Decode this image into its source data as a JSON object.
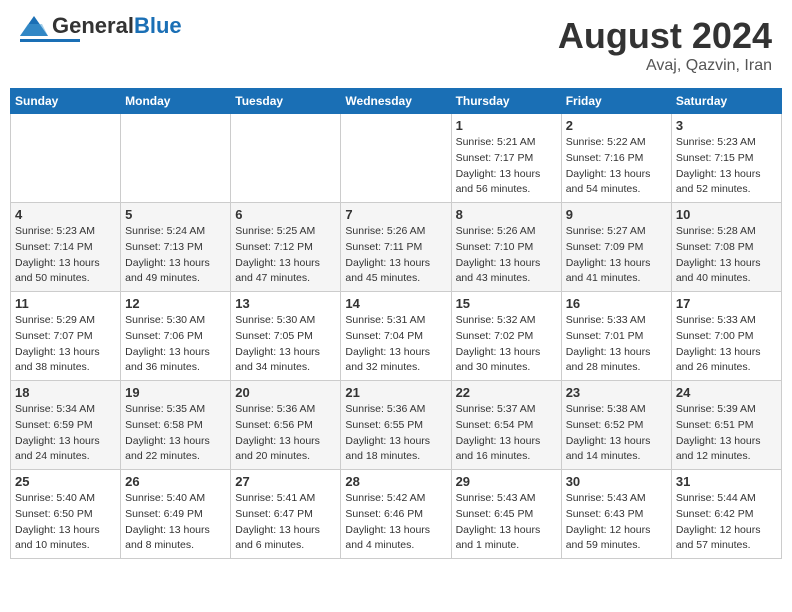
{
  "header": {
    "logo_general": "General",
    "logo_blue": "Blue",
    "month": "August 2024",
    "location": "Avaj, Qazvin, Iran"
  },
  "days_of_week": [
    "Sunday",
    "Monday",
    "Tuesday",
    "Wednesday",
    "Thursday",
    "Friday",
    "Saturday"
  ],
  "weeks": [
    [
      {
        "day": "",
        "content": ""
      },
      {
        "day": "",
        "content": ""
      },
      {
        "day": "",
        "content": ""
      },
      {
        "day": "",
        "content": ""
      },
      {
        "day": "1",
        "content": "Sunrise: 5:21 AM\nSunset: 7:17 PM\nDaylight: 13 hours\nand 56 minutes."
      },
      {
        "day": "2",
        "content": "Sunrise: 5:22 AM\nSunset: 7:16 PM\nDaylight: 13 hours\nand 54 minutes."
      },
      {
        "day": "3",
        "content": "Sunrise: 5:23 AM\nSunset: 7:15 PM\nDaylight: 13 hours\nand 52 minutes."
      }
    ],
    [
      {
        "day": "4",
        "content": "Sunrise: 5:23 AM\nSunset: 7:14 PM\nDaylight: 13 hours\nand 50 minutes."
      },
      {
        "day": "5",
        "content": "Sunrise: 5:24 AM\nSunset: 7:13 PM\nDaylight: 13 hours\nand 49 minutes."
      },
      {
        "day": "6",
        "content": "Sunrise: 5:25 AM\nSunset: 7:12 PM\nDaylight: 13 hours\nand 47 minutes."
      },
      {
        "day": "7",
        "content": "Sunrise: 5:26 AM\nSunset: 7:11 PM\nDaylight: 13 hours\nand 45 minutes."
      },
      {
        "day": "8",
        "content": "Sunrise: 5:26 AM\nSunset: 7:10 PM\nDaylight: 13 hours\nand 43 minutes."
      },
      {
        "day": "9",
        "content": "Sunrise: 5:27 AM\nSunset: 7:09 PM\nDaylight: 13 hours\nand 41 minutes."
      },
      {
        "day": "10",
        "content": "Sunrise: 5:28 AM\nSunset: 7:08 PM\nDaylight: 13 hours\nand 40 minutes."
      }
    ],
    [
      {
        "day": "11",
        "content": "Sunrise: 5:29 AM\nSunset: 7:07 PM\nDaylight: 13 hours\nand 38 minutes."
      },
      {
        "day": "12",
        "content": "Sunrise: 5:30 AM\nSunset: 7:06 PM\nDaylight: 13 hours\nand 36 minutes."
      },
      {
        "day": "13",
        "content": "Sunrise: 5:30 AM\nSunset: 7:05 PM\nDaylight: 13 hours\nand 34 minutes."
      },
      {
        "day": "14",
        "content": "Sunrise: 5:31 AM\nSunset: 7:04 PM\nDaylight: 13 hours\nand 32 minutes."
      },
      {
        "day": "15",
        "content": "Sunrise: 5:32 AM\nSunset: 7:02 PM\nDaylight: 13 hours\nand 30 minutes."
      },
      {
        "day": "16",
        "content": "Sunrise: 5:33 AM\nSunset: 7:01 PM\nDaylight: 13 hours\nand 28 minutes."
      },
      {
        "day": "17",
        "content": "Sunrise: 5:33 AM\nSunset: 7:00 PM\nDaylight: 13 hours\nand 26 minutes."
      }
    ],
    [
      {
        "day": "18",
        "content": "Sunrise: 5:34 AM\nSunset: 6:59 PM\nDaylight: 13 hours\nand 24 minutes."
      },
      {
        "day": "19",
        "content": "Sunrise: 5:35 AM\nSunset: 6:58 PM\nDaylight: 13 hours\nand 22 minutes."
      },
      {
        "day": "20",
        "content": "Sunrise: 5:36 AM\nSunset: 6:56 PM\nDaylight: 13 hours\nand 20 minutes."
      },
      {
        "day": "21",
        "content": "Sunrise: 5:36 AM\nSunset: 6:55 PM\nDaylight: 13 hours\nand 18 minutes."
      },
      {
        "day": "22",
        "content": "Sunrise: 5:37 AM\nSunset: 6:54 PM\nDaylight: 13 hours\nand 16 minutes."
      },
      {
        "day": "23",
        "content": "Sunrise: 5:38 AM\nSunset: 6:52 PM\nDaylight: 13 hours\nand 14 minutes."
      },
      {
        "day": "24",
        "content": "Sunrise: 5:39 AM\nSunset: 6:51 PM\nDaylight: 13 hours\nand 12 minutes."
      }
    ],
    [
      {
        "day": "25",
        "content": "Sunrise: 5:40 AM\nSunset: 6:50 PM\nDaylight: 13 hours\nand 10 minutes."
      },
      {
        "day": "26",
        "content": "Sunrise: 5:40 AM\nSunset: 6:49 PM\nDaylight: 13 hours\nand 8 minutes."
      },
      {
        "day": "27",
        "content": "Sunrise: 5:41 AM\nSunset: 6:47 PM\nDaylight: 13 hours\nand 6 minutes."
      },
      {
        "day": "28",
        "content": "Sunrise: 5:42 AM\nSunset: 6:46 PM\nDaylight: 13 hours\nand 4 minutes."
      },
      {
        "day": "29",
        "content": "Sunrise: 5:43 AM\nSunset: 6:45 PM\nDaylight: 13 hours\nand 1 minute."
      },
      {
        "day": "30",
        "content": "Sunrise: 5:43 AM\nSunset: 6:43 PM\nDaylight: 12 hours\nand 59 minutes."
      },
      {
        "day": "31",
        "content": "Sunrise: 5:44 AM\nSunset: 6:42 PM\nDaylight: 12 hours\nand 57 minutes."
      }
    ]
  ]
}
